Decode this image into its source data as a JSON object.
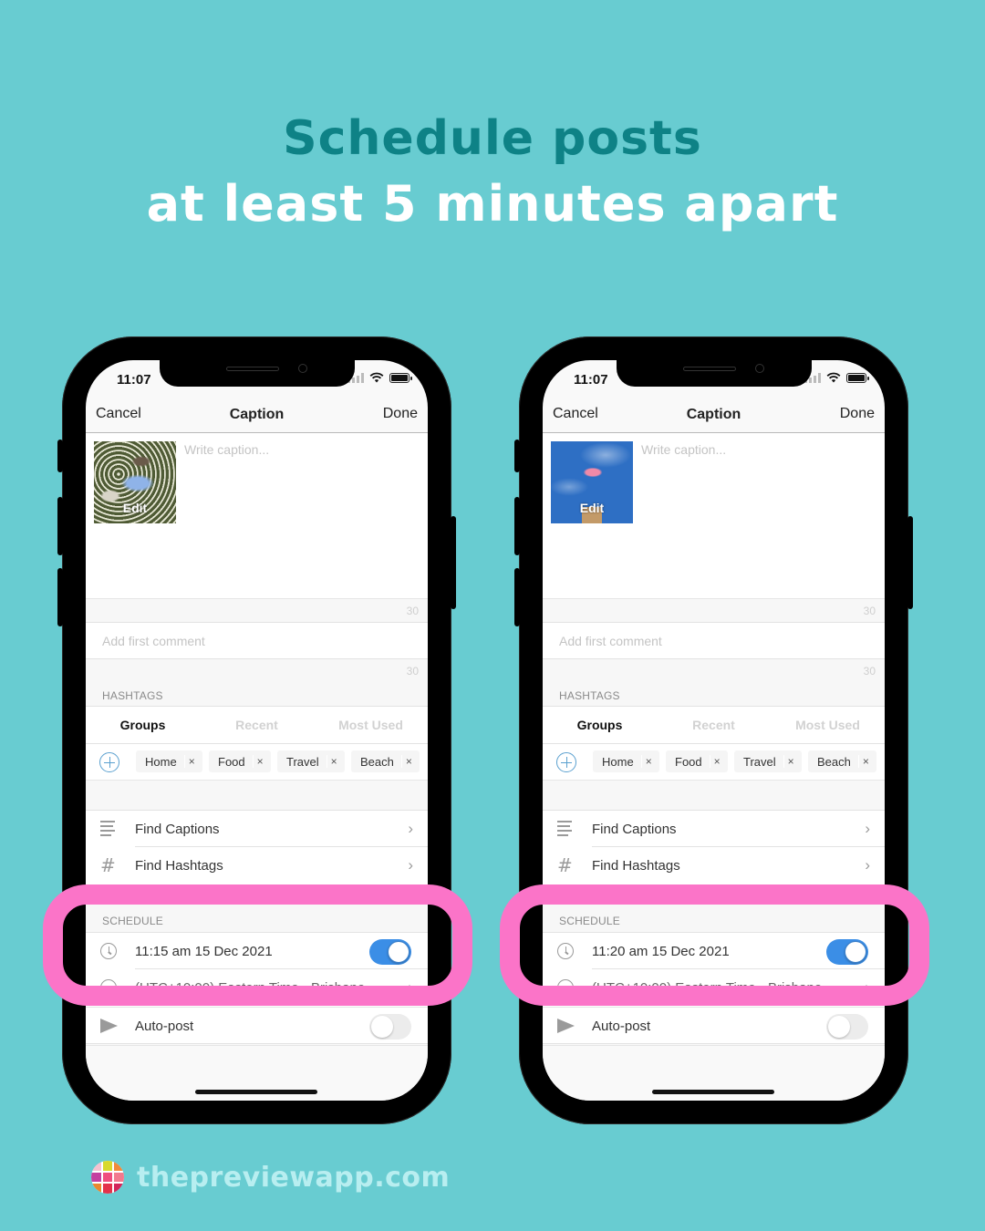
{
  "headline": {
    "line1": "Schedule posts",
    "line2": "at least 5 minutes apart"
  },
  "colors": {
    "background": "#68ccd1",
    "headline_accent": "#0e8286",
    "highlight": "#fb74c8",
    "toggle_on": "#3b8ee6"
  },
  "phones": [
    {
      "status": {
        "time": "11:07"
      },
      "nav": {
        "cancel": "Cancel",
        "title": "Caption",
        "done": "Done"
      },
      "thumbnail": {
        "edit_label": "Edit",
        "subject": "woman in flower field"
      },
      "caption": {
        "placeholder": "Write caption...",
        "value": ""
      },
      "caption_counter": "30",
      "comment": {
        "placeholder": "Add first comment",
        "value": ""
      },
      "comment_counter": "30",
      "hashtags": {
        "section_label": "HASHTAGS",
        "tabs": [
          {
            "label": "Groups",
            "active": true
          },
          {
            "label": "Recent",
            "active": false
          },
          {
            "label": "Most Used",
            "active": false
          }
        ],
        "chips": [
          {
            "label": "Home",
            "remove": "×"
          },
          {
            "label": "Food",
            "remove": "×"
          },
          {
            "label": "Travel",
            "remove": "×"
          },
          {
            "label": "Beach",
            "remove": "×"
          }
        ]
      },
      "tools": [
        {
          "icon": "lines-icon",
          "label": "Find Captions",
          "chevron": "›"
        },
        {
          "icon": "hashtag-icon",
          "label": "Find Hashtags",
          "chevron": "›"
        }
      ],
      "schedule": {
        "section_label": "SCHEDULE",
        "datetime": "11:15 am  15 Dec 2021",
        "enabled": true,
        "timezone": "(UTC+10:00) Eastern Time - Brisbane",
        "timezone_chevron": "›"
      },
      "autopost": {
        "label": "Auto-post",
        "enabled": false
      }
    },
    {
      "status": {
        "time": "11:07"
      },
      "nav": {
        "cancel": "Cancel",
        "title": "Caption",
        "done": "Done"
      },
      "thumbnail": {
        "edit_label": "Edit",
        "subject": "pink flowers against blue sky"
      },
      "caption": {
        "placeholder": "Write caption...",
        "value": ""
      },
      "caption_counter": "30",
      "comment": {
        "placeholder": "Add first comment",
        "value": ""
      },
      "comment_counter": "30",
      "hashtags": {
        "section_label": "HASHTAGS",
        "tabs": [
          {
            "label": "Groups",
            "active": true
          },
          {
            "label": "Recent",
            "active": false
          },
          {
            "label": "Most Used",
            "active": false
          }
        ],
        "chips": [
          {
            "label": "Home",
            "remove": "×"
          },
          {
            "label": "Food",
            "remove": "×"
          },
          {
            "label": "Travel",
            "remove": "×"
          },
          {
            "label": "Beach",
            "remove": "×"
          }
        ]
      },
      "tools": [
        {
          "icon": "lines-icon",
          "label": "Find Captions",
          "chevron": "›"
        },
        {
          "icon": "hashtag-icon",
          "label": "Find Hashtags",
          "chevron": "›"
        }
      ],
      "schedule": {
        "section_label": "SCHEDULE",
        "datetime": "11:20 am  15 Dec 2021",
        "enabled": true,
        "timezone": "(UTC+10:00) Eastern Time - Brisbane",
        "timezone_chevron": "›"
      },
      "autopost": {
        "label": "Auto-post",
        "enabled": false
      }
    }
  ],
  "brand": {
    "text": "thepreviewapp.com",
    "logo_colors": [
      "#f4c2d0",
      "#d8d92c",
      "#f28a3b",
      "#c43fa0",
      "#ef4e7e",
      "#f27a8e",
      "#e9872f",
      "#e4314a",
      "#d3265a"
    ]
  }
}
